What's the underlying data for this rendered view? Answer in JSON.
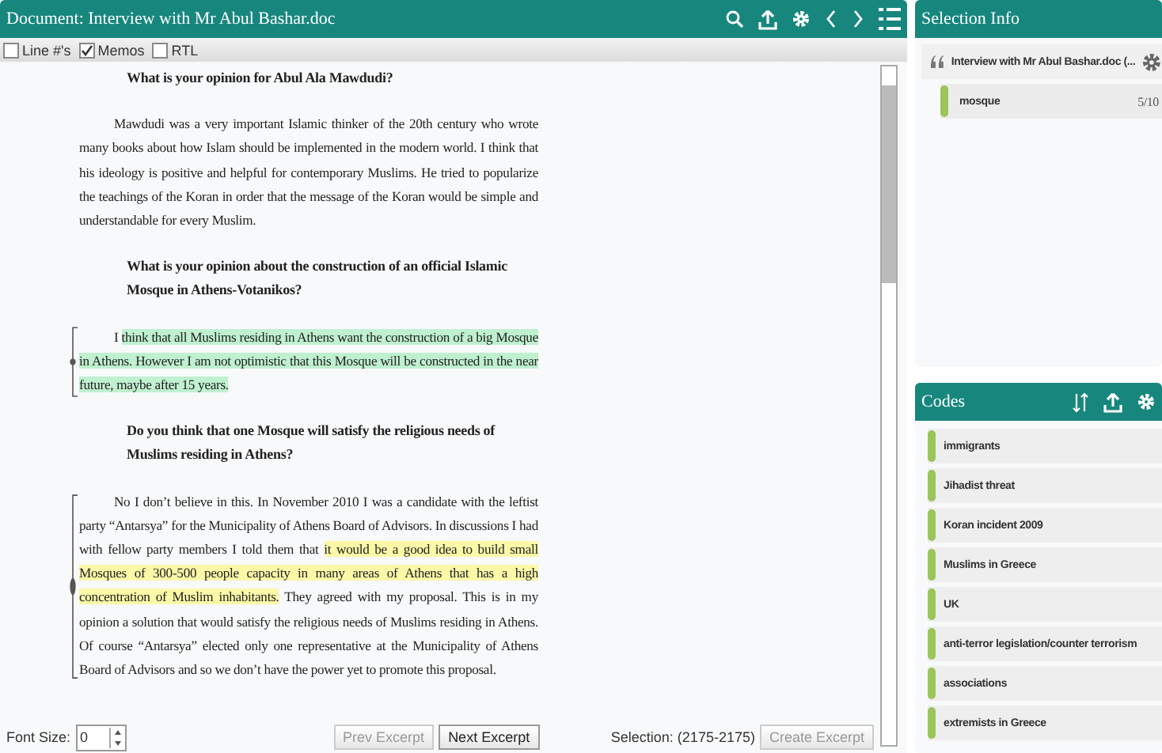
{
  "document": {
    "title": "Document: Interview with Mr Abul Bashar.doc",
    "options": [
      {
        "label": "Line #'s",
        "checked": false
      },
      {
        "label": "Memos",
        "checked": true
      },
      {
        "label": "RTL",
        "checked": false
      }
    ],
    "paragraphs": [
      {
        "kind": "question",
        "memo": false,
        "segments": [
          {
            "text": "What is your opinion for Abul Ala Mawdudi?"
          }
        ]
      },
      {
        "kind": "answer",
        "memo": false,
        "segments": [
          {
            "text": "Mawdudi was a very important Islamic thinker of the 20th century who wrote many books about how Islam should be implemented in the modern world. I think that his ideology is positive and helpful for contemporary Muslims. He tried to popularize the teachings of the Koran in order that the message of the Koran would be simple and understandable for every Muslim."
          }
        ]
      },
      {
        "kind": "question",
        "memo": false,
        "segments": [
          {
            "text": "What is your opinion about the construction of an official Islamic Mosque in Athens-Votanikos?"
          }
        ]
      },
      {
        "kind": "answer",
        "memo": true,
        "segments": [
          {
            "text": "I "
          },
          {
            "text": "think that all Muslims residing in Athens want the construction of a big Mosque in Athens. However I am not optimistic that this Mosque will be constructed in the near future, maybe after 15 years.",
            "color": "#bff0cf"
          }
        ]
      },
      {
        "kind": "question",
        "memo": false,
        "segments": [
          {
            "text": "Do you think that one Mosque will satisfy the religious needs of Muslims residing in Athens?"
          }
        ]
      },
      {
        "kind": "answer",
        "memo": true,
        "segments": [
          {
            "text": "No I don’t believe in this. In November 2010 I was a candidate with the leftist party “Antarsya” for the Municipality of Athens Board of Advisors. In discussions I had with fellow party members I told them that "
          },
          {
            "text": "it would be a good idea to build small Mosques of 300-500 people capacity in many areas of Athens that has a high concentration of Muslim inhabitants.",
            "color": "#fbf8a8"
          },
          {
            "text": " They agreed with my proposal. This is in my opinion a solution that would satisfy the religious needs of Muslims residing in Athens. Of course “Antarsya” elected only one representative at the Municipality of Athens Board of Advisors and so we don’t have the power yet to promote this proposal."
          }
        ]
      }
    ],
    "font_size_label": "Font Size:",
    "font_size": "0",
    "prev_button": "Prev Excerpt",
    "next_button": "Next Excerpt",
    "selection": "Selection: (2175-2175)",
    "create_button": "Create Excerpt"
  },
  "selection_info": {
    "title": "Selection Info",
    "document": "Interview with Mr Abul Bashar.doc (...",
    "codes": [
      {
        "name": "mosque",
        "count": "5/10"
      }
    ]
  },
  "codes": {
    "title": "Codes",
    "items": [
      "immigrants",
      "Jihadist threat",
      "Koran incident 2009",
      "Muslims in Greece",
      "UK",
      "anti-terror legislation/counter terrorism",
      "associations",
      "extremists in Greece"
    ]
  }
}
